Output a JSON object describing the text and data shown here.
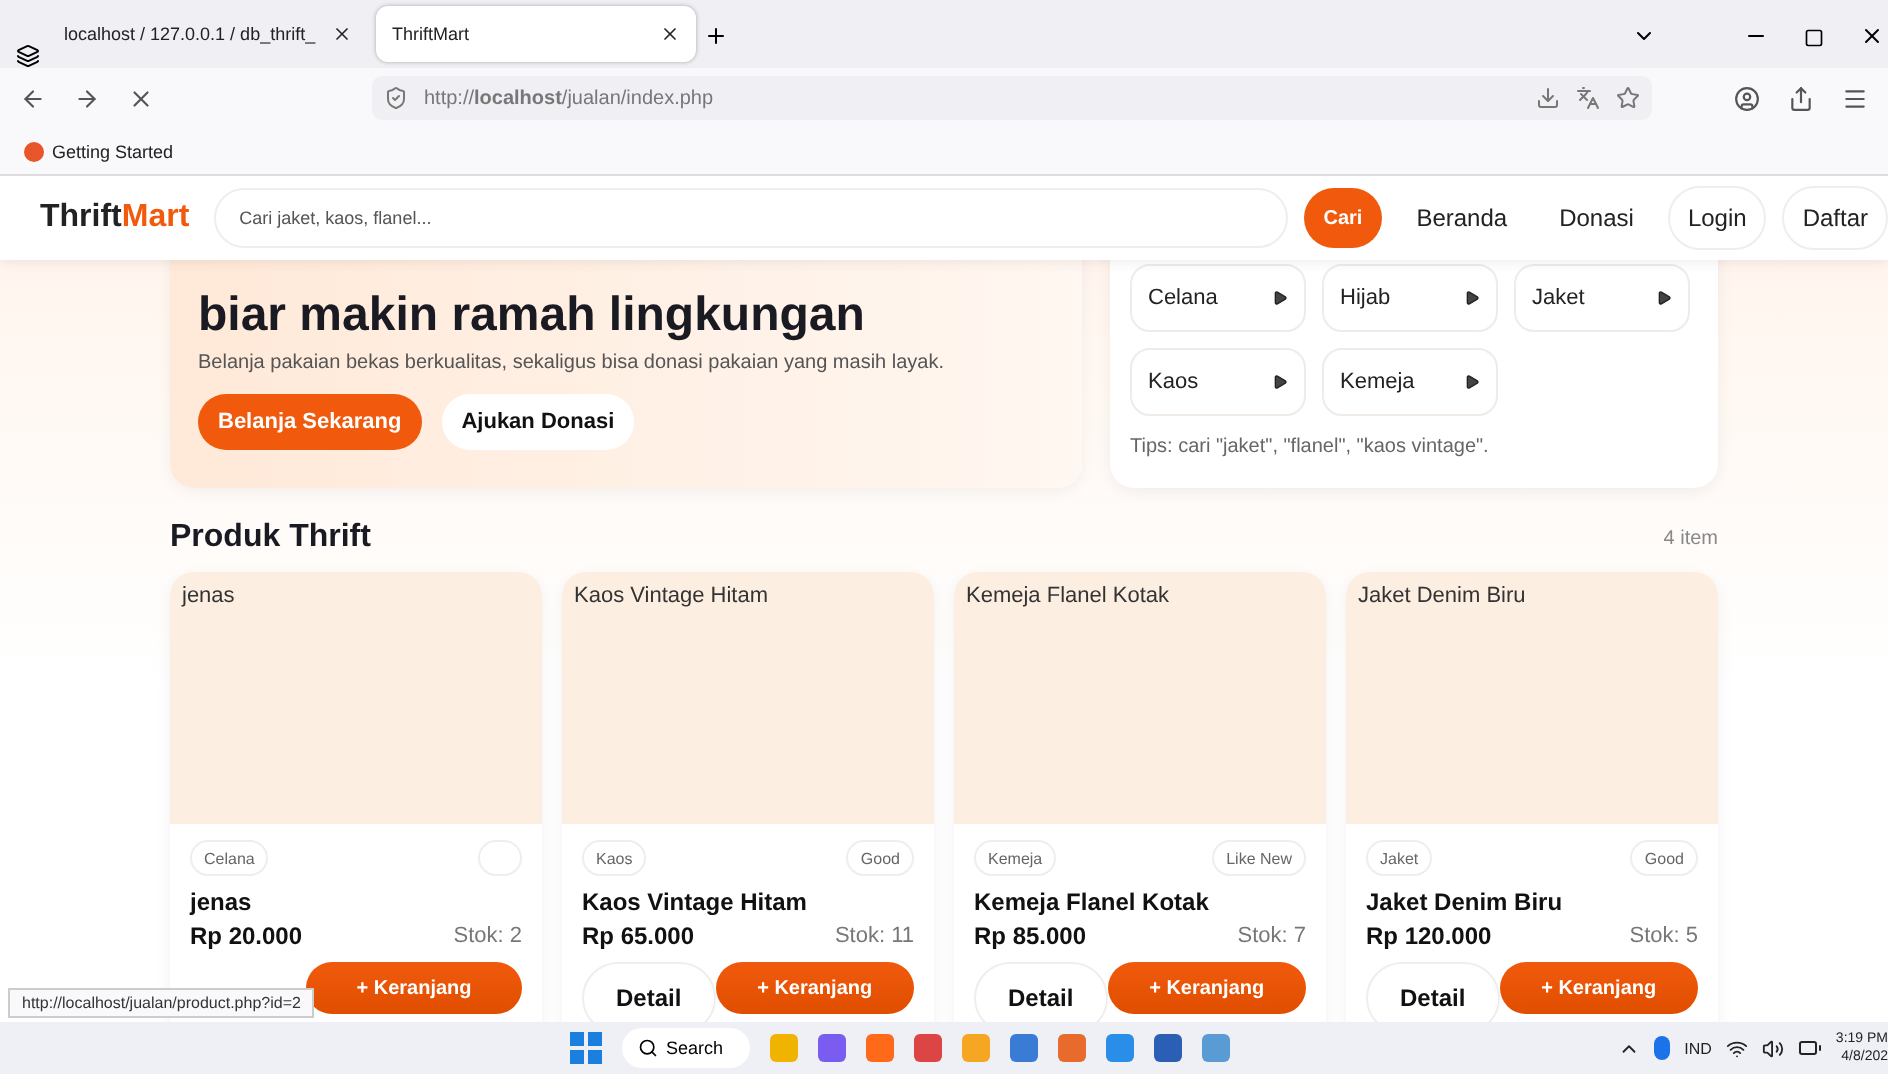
{
  "browser": {
    "tabs": [
      {
        "title": "localhost / 127.0.0.1 / db_thrift_",
        "selected": false
      },
      {
        "title": "ThriftMart",
        "selected": true
      }
    ],
    "url": "http://**localhost**/jualan/index.php",
    "bookmarks": [
      "Getting Started"
    ]
  },
  "site": {
    "brand": [
      "Thrift",
      "Mart"
    ],
    "search": {
      "placeholder": "Cari jaket, kaos, flanel..."
    },
    "search_button": "Cari",
    "nav": [
      {
        "label": "Beranda",
        "kind": "link"
      },
      {
        "label": "Donasi",
        "kind": "link"
      },
      {
        "label": "Login",
        "kind": "pill"
      },
      {
        "label": "Daftar",
        "kind": "pill"
      }
    ]
  },
  "hero": {
    "title_lines": [
      "biar makin ramah lingkungan"
    ],
    "subtitle": "Belanja pakaian bekas berkualitas, sekaligus bisa donasi pakaian yang masih layak.",
    "buttons": [
      {
        "label": "Belanja Sekarang",
        "kind": "primary"
      },
      {
        "label": "Ajukan Donasi",
        "kind": "secondary"
      }
    ]
  },
  "categories": {
    "items": [
      "Celana",
      "Hijab",
      "Jaket",
      "Kaos",
      "Kemeja"
    ],
    "tip": "Tips: cari \"jaket\", \"flanel\", \"kaos vintage\"."
  },
  "products": {
    "title": "Produk Thrift",
    "count": "4 item",
    "items": [
      {
        "image_label": "jenas",
        "category": "Celana",
        "name": "jenas",
        "price": "Rp 20.000",
        "stock": "Stok: 2",
        "cart": "+ Keranjang"
      },
      {
        "image_label": "Kaos Vintage Hitam",
        "category": "Kaos",
        "condition": "Good",
        "name": "Kaos Vintage Hitam",
        "price": "Rp 65.000",
        "stock": "Stok: 11",
        "detail": "Detail",
        "cart": "+ Keranjang"
      },
      {
        "image_label": "Kemeja Flanel Kotak",
        "category": "Kemeja",
        "condition": "Like New",
        "name": "Kemeja Flanel Kotak",
        "price": "Rp 85.000",
        "stock": "Stok: 7",
        "detail": "Detail",
        "cart": "+ Keranjang"
      },
      {
        "image_label": "Jaket Denim Biru",
        "category": "Jaket",
        "condition": "Good",
        "name": "Jaket Denim Biru",
        "price": "Rp 120.000",
        "stock": "Stok: 5",
        "detail": "Detail",
        "cart": "+ Keranjang"
      }
    ]
  },
  "status_url": "http://localhost/jualan/product.php?id=2",
  "taskbar": {
    "search": "Search",
    "language": "IND",
    "time": "3:19 PM",
    "date": "4/8/202"
  }
}
